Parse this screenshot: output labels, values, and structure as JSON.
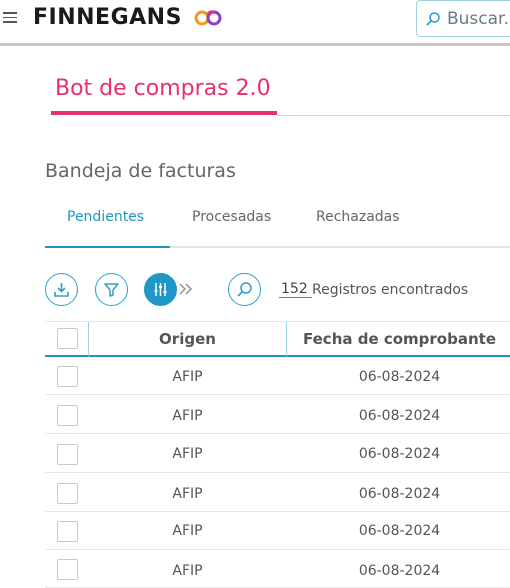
{
  "app": {
    "brand": "FINNEGANS",
    "search_placeholder": "Buscar..."
  },
  "page": {
    "title": "Bot de compras 2.0",
    "section_title": "Bandeja de facturas"
  },
  "tabs": [
    {
      "label": "Pendientes",
      "active": true
    },
    {
      "label": "Procesadas",
      "active": false
    },
    {
      "label": "Rechazadas",
      "active": false
    }
  ],
  "toolbar": {
    "records_count": "152",
    "records_label": "Registros encontrados"
  },
  "table": {
    "columns": [
      "Origen",
      "Fecha de comprobante"
    ],
    "rows": [
      {
        "origen": "AFIP",
        "fecha": "06-08-2024"
      },
      {
        "origen": "AFIP",
        "fecha": "06-08-2024"
      },
      {
        "origen": "AFIP",
        "fecha": "06-08-2024"
      },
      {
        "origen": "AFIP",
        "fecha": "06-08-2024"
      },
      {
        "origen": "AFIP",
        "fecha": "06-08-2024"
      },
      {
        "origen": "AFIP",
        "fecha": "06-08-2024"
      }
    ]
  },
  "colors": {
    "accent_pink": "#e6306f",
    "accent_blue": "#2196c4",
    "logo_orange": "#f29a1f",
    "logo_purple": "#8d3fc9"
  },
  "icons": [
    "menu-icon",
    "logo-infinity-icon",
    "search-icon",
    "download-icon",
    "filter-icon",
    "sliders-icon",
    "double-chevron-right-icon",
    "search-records-icon"
  ]
}
